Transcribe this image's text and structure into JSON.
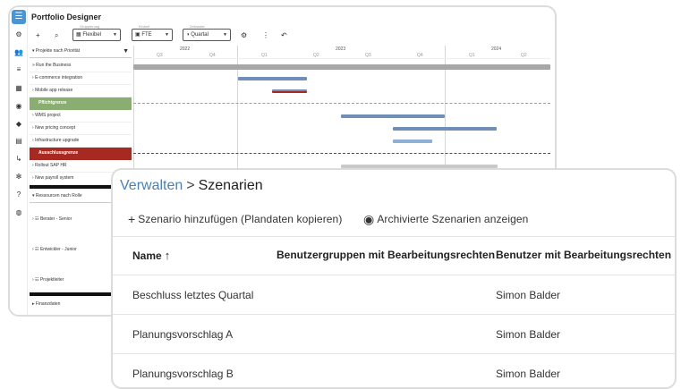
{
  "back_window": {
    "title": "Portfolio Designer",
    "toolbar": {
      "grouping": {
        "label": "Gruppierung",
        "value": "Flexibel"
      },
      "unit": {
        "label": "Einheit",
        "value": "FTE"
      },
      "granularity": {
        "label": "Zeitraster",
        "value": "Quartal"
      }
    },
    "tree_header": "Projekte nach Priorität",
    "rows": [
      "Run the Business",
      "E-commerce integration",
      "Mobile app release",
      "Pflichtgrenze",
      "WMS project",
      "New pricing concept",
      "Infrastructure upgrade",
      "Ausschlussgrenze",
      "Rollout SAP HR",
      "New payroll system"
    ],
    "resources_header": "Ressourcen nach Rolle",
    "resources": [
      "Berater - Senior",
      "Entwickler - Junior",
      "Projektleiter"
    ],
    "finance": "Finanzdaten",
    "years": [
      "2022",
      "2023",
      "2024"
    ],
    "quarters": [
      "Q3",
      "Q4",
      "Q1",
      "Q2",
      "Q3",
      "Q4",
      "Q1",
      "Q2"
    ],
    "colors": {
      "must_band": "#8aad72",
      "exclude_band": "#a62a22",
      "bar": "#6f8fb8",
      "bar_light": "#8fb0d6",
      "bar_grey": "#c9c9c9",
      "rtb": "#a7a7a7"
    }
  },
  "scenarios": {
    "breadcrumb": {
      "parent": "Verwalten",
      "separator": ">",
      "current": "Szenarien"
    },
    "actions": {
      "add": "Szenario hinzufügen (Plandaten kopieren)",
      "archived": "Archivierte Szenarien anzeigen"
    },
    "columns": {
      "name": "Name",
      "groups": "Benutzergruppen mit Bearbeitungsrechten",
      "users": "Benutzer mit Bearbeitungsrechten"
    },
    "rows": [
      {
        "name": "Beschluss letztes Quartal",
        "groups": "",
        "users": "Simon Balder"
      },
      {
        "name": "Planungsvorschlag A",
        "groups": "",
        "users": "Simon Balder"
      },
      {
        "name": "Planungsvorschlag B",
        "groups": "",
        "users": "Simon Balder"
      }
    ]
  }
}
